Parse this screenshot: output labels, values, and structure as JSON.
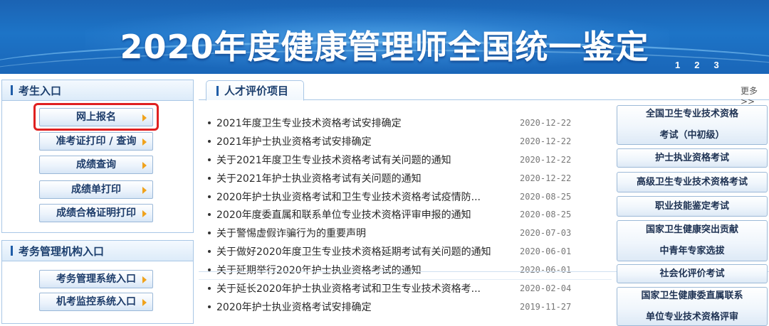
{
  "banner": {
    "title": "2020年度健康管理师全国统一鉴定",
    "slides": [
      "1",
      "2",
      "3"
    ]
  },
  "candidate_entry": {
    "heading": "考生入口",
    "buttons": [
      "网上报名",
      "准考证打印 / 查询",
      "成绩查询",
      "成绩单打印",
      "成绩合格证明打印"
    ]
  },
  "admin_entry": {
    "heading": "考务管理机构入口",
    "buttons": [
      "考务管理系统入口",
      "机考监控系统入口"
    ]
  },
  "center": {
    "tab_label": "人才评价项目",
    "more_label": "更多>>",
    "news": [
      {
        "title": "2021年度卫生专业技术资格考试安排确定",
        "date": "2020-12-22"
      },
      {
        "title": "2021年护士执业资格考试安排确定",
        "date": "2020-12-22"
      },
      {
        "title": "关于2021年度卫生专业技术资格考试有关问题的通知",
        "date": "2020-12-22"
      },
      {
        "title": "关于2021年护士执业资格考试有关问题的通知",
        "date": "2020-12-22"
      },
      {
        "title": "2020年护士执业资格考试和卫生专业技术资格考试疫情防...",
        "date": "2020-08-25"
      },
      {
        "title": "2020年度委直属和联系单位专业技术资格评审申报的通知",
        "date": "2020-08-25"
      },
      {
        "title": "关于警惕虚假诈骗行为的重要声明",
        "date": "2020-07-03"
      },
      {
        "title": "关于做好2020年度卫生专业技术资格延期考试有关问题的通知",
        "date": "2020-06-01"
      },
      {
        "title": "关于延期举行2020年护士执业资格考试的通知",
        "date": "2020-06-01"
      },
      {
        "title": "关于延长2020年护士执业资格考试和卫生专业技术资格考...",
        "date": "2020-02-04"
      },
      {
        "title": "2020年护士执业资格考试安排确定",
        "date": "2019-11-27"
      }
    ]
  },
  "right_links": [
    {
      "lines": [
        "全国卫生专业技术资格",
        "考试（中初级）"
      ]
    },
    {
      "lines": [
        "护士执业资格考试"
      ]
    },
    {
      "lines": [
        "高级卫生专业技术资格考试"
      ]
    },
    {
      "lines": [
        "职业技能鉴定考试"
      ]
    },
    {
      "lines": [
        "国家卫生健康突出贡献",
        "中青年专家选拔"
      ]
    },
    {
      "lines": [
        "社会化评价考试"
      ]
    },
    {
      "lines": [
        "国家卫生健康委直属联系",
        "单位专业技术资格评审"
      ]
    }
  ],
  "colors": {
    "banner_blue": "#1d74c7",
    "accent_orange": "#f0a21c",
    "highlight_red": "#e02020",
    "heading_text": "#1c3f6e"
  }
}
